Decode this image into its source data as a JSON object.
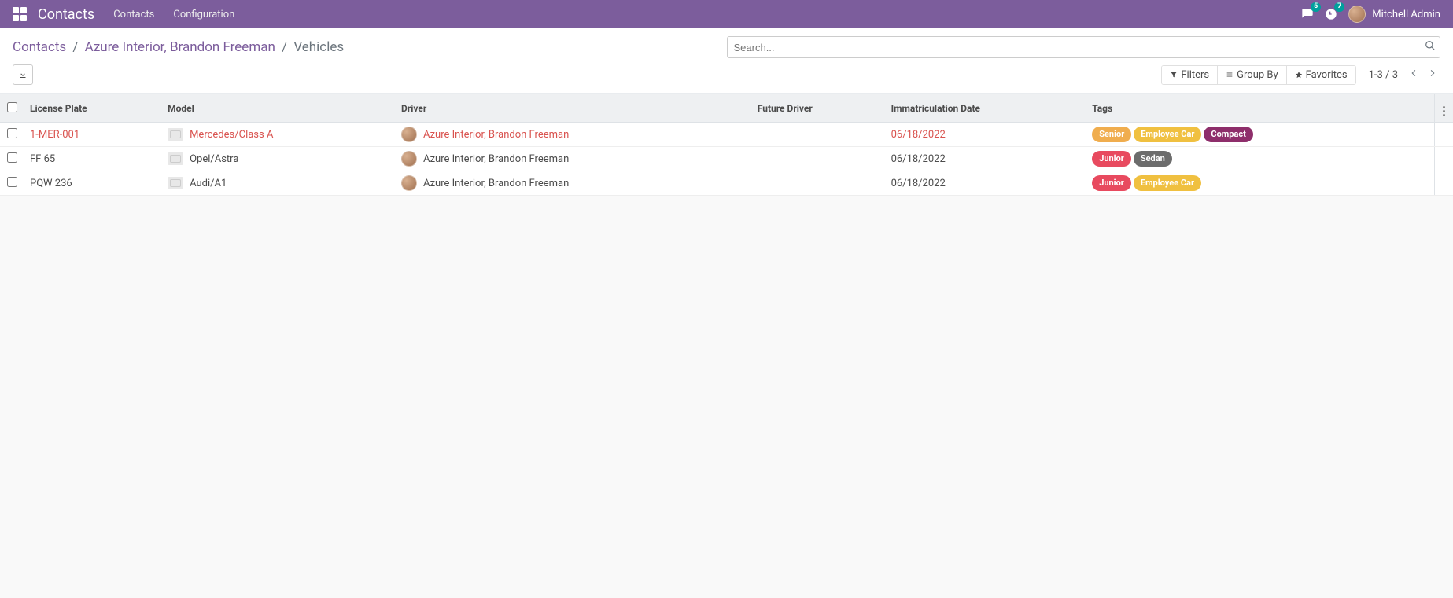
{
  "navbar": {
    "app_title": "Contacts",
    "links": [
      "Contacts",
      "Configuration"
    ],
    "messages_badge": "5",
    "activities_badge": "7",
    "username": "Mitchell Admin"
  },
  "breadcrumb": {
    "root": "Contacts",
    "parent": "Azure Interior, Brandon Freeman",
    "current": "Vehicles"
  },
  "search": {
    "placeholder": "Search..."
  },
  "search_options": {
    "filters": "Filters",
    "group_by": "Group By",
    "favorites": "Favorites"
  },
  "pager": {
    "range": "1-3",
    "sep": "/",
    "total": "3"
  },
  "table": {
    "columns": [
      "License Plate",
      "Model",
      "Driver",
      "Future Driver",
      "Immatriculation Date",
      "Tags"
    ],
    "rows": [
      {
        "highlight": true,
        "license": "1-MER-001",
        "model": "Mercedes/Class A",
        "driver": "Azure Interior, Brandon Freeman",
        "future_driver": "",
        "date": "06/18/2022",
        "tags": [
          {
            "label": "Senior",
            "color": "#f0ad4e"
          },
          {
            "label": "Employee Car",
            "color": "#f0c040"
          },
          {
            "label": "Compact",
            "color": "#8e2e6b"
          }
        ]
      },
      {
        "highlight": false,
        "license": "FF 65",
        "model": "Opel/Astra",
        "driver": "Azure Interior, Brandon Freeman",
        "future_driver": "",
        "date": "06/18/2022",
        "tags": [
          {
            "label": "Junior",
            "color": "#e84a5f"
          },
          {
            "label": "Sedan",
            "color": "#6c6c6c"
          }
        ]
      },
      {
        "highlight": false,
        "license": "PQW 236",
        "model": "Audi/A1",
        "driver": "Azure Interior, Brandon Freeman",
        "future_driver": "",
        "date": "06/18/2022",
        "tags": [
          {
            "label": "Junior",
            "color": "#e84a5f"
          },
          {
            "label": "Employee Car",
            "color": "#f0c040"
          }
        ]
      }
    ]
  }
}
